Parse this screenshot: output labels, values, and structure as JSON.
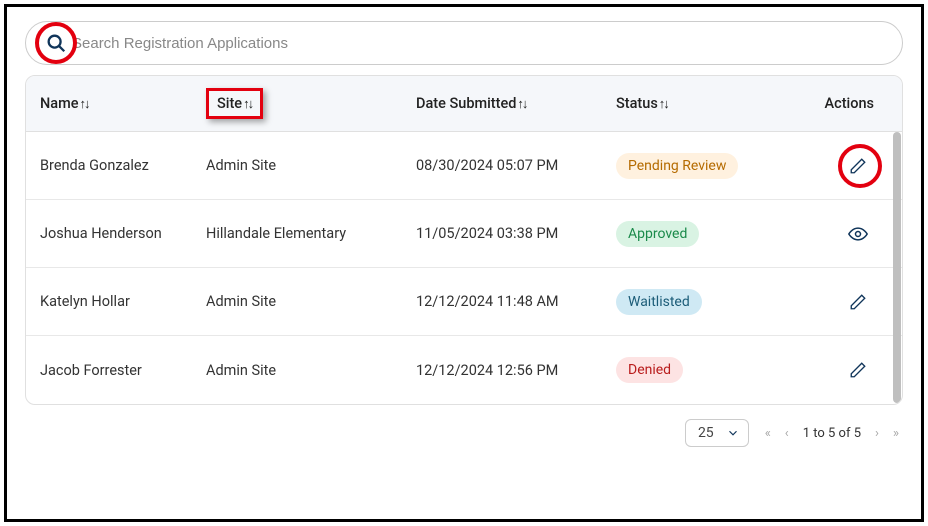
{
  "search": {
    "placeholder": "Search Registration Applications"
  },
  "columns": {
    "name": "Name",
    "site": "Site",
    "date": "Date Submitted",
    "status": "Status",
    "actions": "Actions"
  },
  "rows": [
    {
      "name": "Brenda Gonzalez",
      "site": "Admin Site",
      "date": "08/30/2024 05:07 PM",
      "status_label": "Pending Review",
      "status_class": "status-pending",
      "action": "edit",
      "highlight": true
    },
    {
      "name": "Joshua Henderson",
      "site": "Hillandale Elementary",
      "date": "11/05/2024 03:38 PM",
      "status_label": "Approved",
      "status_class": "status-approved",
      "action": "view",
      "highlight": false
    },
    {
      "name": "Katelyn Hollar",
      "site": "Admin Site",
      "date": "12/12/2024 11:48 AM",
      "status_label": "Waitlisted",
      "status_class": "status-waitlisted",
      "action": "edit",
      "highlight": false
    },
    {
      "name": "Jacob Forrester",
      "site": "Admin Site",
      "date": "12/12/2024 12:56 PM",
      "status_label": "Denied",
      "status_class": "status-denied",
      "action": "edit",
      "highlight": false
    }
  ],
  "pager": {
    "page_size": "25",
    "text": "1 to 5 of 5"
  }
}
